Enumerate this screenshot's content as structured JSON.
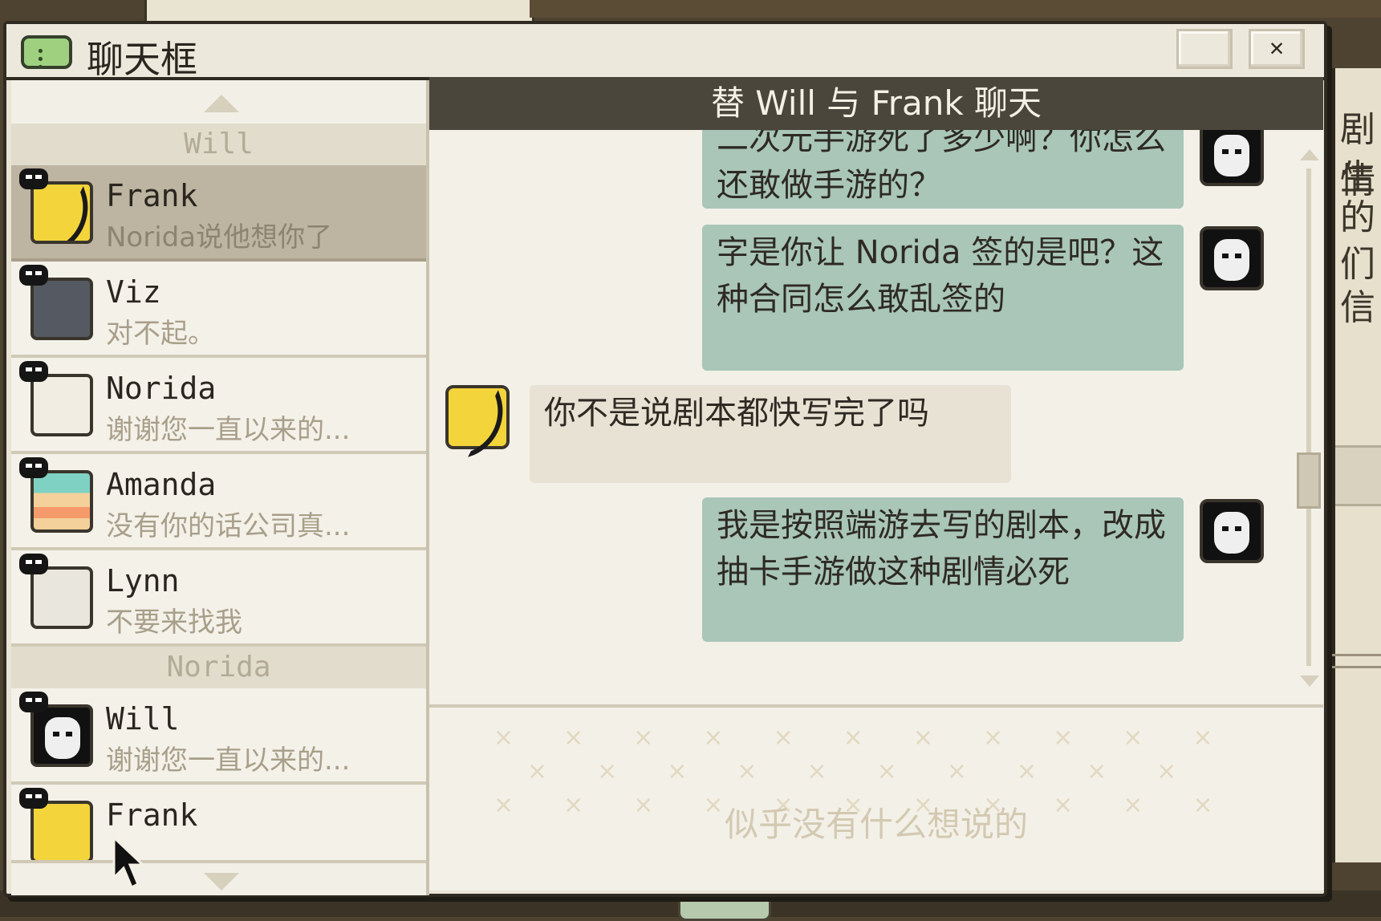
{
  "window": {
    "title": "聊天框"
  },
  "sidebar": {
    "groups": [
      {
        "label": "Will"
      },
      {
        "label": "Norida"
      }
    ],
    "contacts": [
      {
        "name": "Frank",
        "preview": "Norida说他想你了"
      },
      {
        "name": "Viz",
        "preview": "对不起。"
      },
      {
        "name": "Norida",
        "preview": "谢谢您一直以来的..."
      },
      {
        "name": "Amanda",
        "preview": "没有你的话公司真..."
      },
      {
        "name": "Lynn",
        "preview": "不要来找我"
      },
      {
        "name": "Will",
        "preview": "谢谢您一直以来的..."
      },
      {
        "name": "Frank",
        "preview": ""
      }
    ]
  },
  "chat": {
    "header": "替 Will 与 Frank 聊天",
    "messages": [
      {
        "from": "Will",
        "direction": "out",
        "text": "二次元手游死了多少啊？你怎么还敢做手游的？"
      },
      {
        "from": "Will",
        "direction": "out",
        "text": "字是你让 Norida 签的是吧？这种合同怎么敢乱签的"
      },
      {
        "from": "Frank",
        "direction": "in",
        "text": "你不是说剧本都快写完了吗"
      },
      {
        "from": "Will",
        "direction": "out",
        "text": "我是按照端游去写的剧本，改成抽卡手游做这种剧情必死"
      }
    ],
    "input_placeholder": "似乎没有什么想说的"
  },
  "background_text": [
    "剧情",
    "生",
    "的",
    "们",
    "信"
  ],
  "colors": {
    "outgoing_bubble": "#a9c6b8",
    "incoming_bubble": "#e8e2d4",
    "header_bar": "#4a463c",
    "selected_contact": "#bdb4a1"
  }
}
